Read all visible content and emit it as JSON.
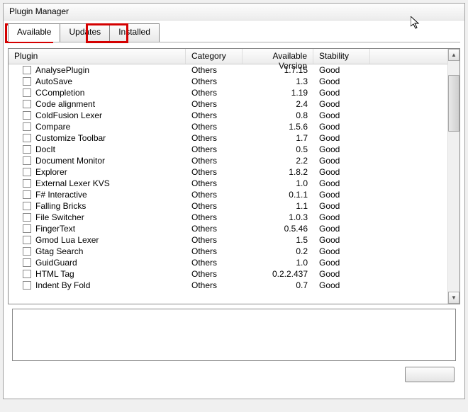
{
  "window": {
    "title": "Plugin Manager"
  },
  "tabs": {
    "available": "Available",
    "updates": "Updates",
    "installed": "Installed"
  },
  "columns": {
    "plugin": "Plugin",
    "category": "Category",
    "version": "Available Version",
    "stability": "Stability"
  },
  "plugins": [
    {
      "name": "AnalysePlugin",
      "category": "Others",
      "version": "1.7.15",
      "stability": "Good"
    },
    {
      "name": "AutoSave",
      "category": "Others",
      "version": "1.3",
      "stability": "Good"
    },
    {
      "name": "CCompletion",
      "category": "Others",
      "version": "1.19",
      "stability": "Good"
    },
    {
      "name": "Code alignment",
      "category": "Others",
      "version": "2.4",
      "stability": "Good"
    },
    {
      "name": "ColdFusion Lexer",
      "category": "Others",
      "version": "0.8",
      "stability": "Good"
    },
    {
      "name": "Compare",
      "category": "Others",
      "version": "1.5.6",
      "stability": "Good"
    },
    {
      "name": "Customize Toolbar",
      "category": "Others",
      "version": "1.7",
      "stability": "Good"
    },
    {
      "name": "DocIt",
      "category": "Others",
      "version": "0.5",
      "stability": "Good"
    },
    {
      "name": "Document Monitor",
      "category": "Others",
      "version": "2.2",
      "stability": "Good"
    },
    {
      "name": "Explorer",
      "category": "Others",
      "version": "1.8.2",
      "stability": "Good"
    },
    {
      "name": "External Lexer KVS",
      "category": "Others",
      "version": "1.0",
      "stability": "Good"
    },
    {
      "name": "F# Interactive",
      "category": "Others",
      "version": "0.1.1",
      "stability": "Good"
    },
    {
      "name": "Falling Bricks",
      "category": "Others",
      "version": "1.1",
      "stability": "Good"
    },
    {
      "name": "File Switcher",
      "category": "Others",
      "version": "1.0.3",
      "stability": "Good"
    },
    {
      "name": "FingerText",
      "category": "Others",
      "version": "0.5.46",
      "stability": "Good"
    },
    {
      "name": "Gmod Lua Lexer",
      "category": "Others",
      "version": "1.5",
      "stability": "Good"
    },
    {
      "name": "Gtag Search",
      "category": "Others",
      "version": "0.2",
      "stability": "Good"
    },
    {
      "name": "GuidGuard",
      "category": "Others",
      "version": "1.0",
      "stability": "Good"
    },
    {
      "name": "HTML Tag",
      "category": "Others",
      "version": "0.2.2.437",
      "stability": "Good"
    },
    {
      "name": "Indent By Fold",
      "category": "Others",
      "version": "0.7",
      "stability": "Good"
    }
  ],
  "chart_data": {
    "type": "table",
    "columns": [
      "Plugin",
      "Category",
      "Available Version",
      "Stability"
    ],
    "rows": [
      [
        "AnalysePlugin",
        "Others",
        "1.7.15",
        "Good"
      ],
      [
        "AutoSave",
        "Others",
        "1.3",
        "Good"
      ],
      [
        "CCompletion",
        "Others",
        "1.19",
        "Good"
      ],
      [
        "Code alignment",
        "Others",
        "2.4",
        "Good"
      ],
      [
        "ColdFusion Lexer",
        "Others",
        "0.8",
        "Good"
      ],
      [
        "Compare",
        "Others",
        "1.5.6",
        "Good"
      ],
      [
        "Customize Toolbar",
        "Others",
        "1.7",
        "Good"
      ],
      [
        "DocIt",
        "Others",
        "0.5",
        "Good"
      ],
      [
        "Document Monitor",
        "Others",
        "2.2",
        "Good"
      ],
      [
        "Explorer",
        "Others",
        "1.8.2",
        "Good"
      ],
      [
        "External Lexer KVS",
        "Others",
        "1.0",
        "Good"
      ],
      [
        "F# Interactive",
        "Others",
        "0.1.1",
        "Good"
      ],
      [
        "Falling Bricks",
        "Others",
        "1.1",
        "Good"
      ],
      [
        "File Switcher",
        "Others",
        "1.0.3",
        "Good"
      ],
      [
        "FingerText",
        "Others",
        "0.5.46",
        "Good"
      ],
      [
        "Gmod Lua Lexer",
        "Others",
        "1.5",
        "Good"
      ],
      [
        "Gtag Search",
        "Others",
        "0.2",
        "Good"
      ],
      [
        "GuidGuard",
        "Others",
        "1.0",
        "Good"
      ],
      [
        "HTML Tag",
        "Others",
        "0.2.2.437",
        "Good"
      ],
      [
        "Indent By Fold",
        "Others",
        "0.7",
        "Good"
      ]
    ]
  }
}
